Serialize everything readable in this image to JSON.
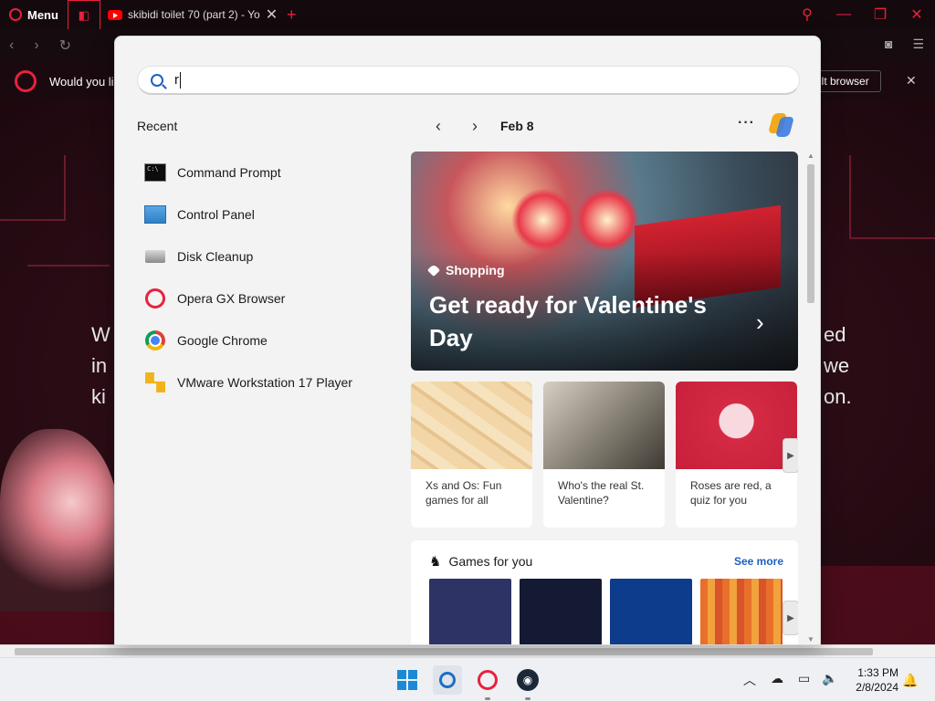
{
  "browser": {
    "menu_label": "Menu",
    "tab_title": "skibidi toilet 70 (part 2) - Yo",
    "new_tab_icon": "plus-icon",
    "infobar_text": "Would you li",
    "default_button": "ult browser",
    "accent": "#e8213f"
  },
  "page": {
    "text_left": [
      "W",
      "in",
      "ki"
    ],
    "text_right": [
      "ed",
      "we",
      "on."
    ]
  },
  "search": {
    "query": "r"
  },
  "recent": {
    "title": "Recent",
    "items": [
      {
        "label": "Command Prompt",
        "icon": "command-prompt-icon"
      },
      {
        "label": "Control Panel",
        "icon": "control-panel-icon"
      },
      {
        "label": "Disk Cleanup",
        "icon": "disk-cleanup-icon"
      },
      {
        "label": "Opera GX Browser",
        "icon": "opera-gx-icon"
      },
      {
        "label": "Google Chrome",
        "icon": "chrome-icon"
      },
      {
        "label": "VMware Workstation 17 Player",
        "icon": "vmware-icon"
      }
    ]
  },
  "widgets": {
    "date": "Feb 8",
    "more": "···",
    "hero": {
      "tag": "Shopping",
      "title": "Get ready for Valentine's Day"
    },
    "cards": [
      {
        "text": "Xs and Os: Fun games for all"
      },
      {
        "text": "Who's the real St. Valentine?"
      },
      {
        "text": "Roses are red, a quiz for you"
      }
    ],
    "games": {
      "title": "Games for you",
      "see_more": "See more",
      "tile_colors": [
        "#2e3366",
        "#141a33",
        "#0d3c8c",
        "#e8702a"
      ]
    }
  },
  "taskbar": {
    "time": "1:33 PM",
    "date": "2/8/2024",
    "accent": "#1a8ad6"
  }
}
